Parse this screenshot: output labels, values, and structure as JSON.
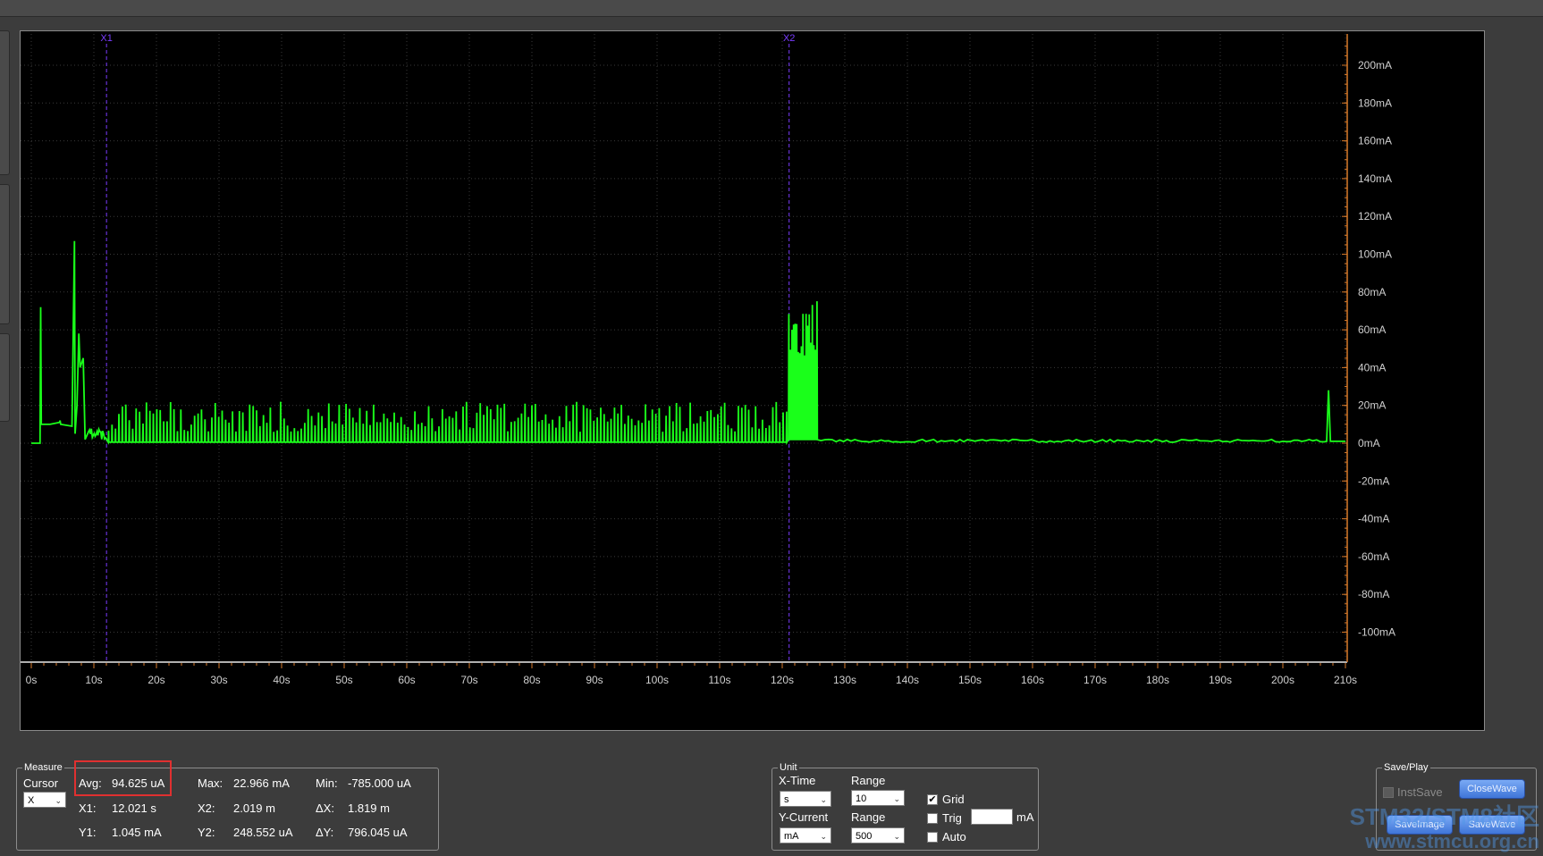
{
  "scope": {
    "x_axis": {
      "labels": [
        "0s",
        "10s",
        "20s",
        "30s",
        "40s",
        "50s",
        "60s",
        "70s",
        "80s",
        "90s",
        "100s",
        "110s",
        "120s",
        "130s",
        "140s",
        "150s",
        "160s",
        "170s",
        "180s",
        "190s",
        "200s",
        "210s"
      ]
    },
    "y_axis": {
      "labels": [
        "200mA",
        "180mA",
        "160mA",
        "140mA",
        "120mA",
        "100mA",
        "80mA",
        "60mA",
        "40mA",
        "20mA",
        "0mA",
        "-20mA",
        "-40mA",
        "-60mA",
        "-80mA",
        "-100mA"
      ]
    },
    "cursor_x1_label": "X1",
    "cursor_x2_label": "X2",
    "trace_color": "#1aff1a",
    "cursor_color": "#7a3cff"
  },
  "measure": {
    "title": "Measure",
    "cursor_label": "Cursor",
    "cursor_value": "X",
    "avg_label": "Avg:",
    "avg_value": "94.625 uA",
    "max_label": "Max:",
    "max_value": "22.966 mA",
    "min_label": "Min:",
    "min_value": "-785.000 uA",
    "x1_label": "X1:",
    "x1_value": "12.021 s",
    "x2_label": "X2:",
    "x2_value": "2.019 m",
    "dx_label": "ΔX:",
    "dx_value": "1.819 m",
    "y1_label": "Y1:",
    "y1_value": "1.045 mA",
    "y2_label": "Y2:",
    "y2_value": "248.552 uA",
    "dy_label": "ΔY:",
    "dy_value": "796.045 uA"
  },
  "unit": {
    "title": "Unit",
    "xtime_label": "X-Time",
    "xtime_value": "s",
    "xrange_label": "Range",
    "xrange_value": "10",
    "ycurrent_label": "Y-Current",
    "ycurrent_value": "mA",
    "yrange_label": "Range",
    "yrange_value": "500",
    "grid_label": "Grid",
    "grid_checked": true,
    "trig_label": "Trig",
    "trig_checked": false,
    "trig_value": "",
    "trig_unit": "mA",
    "auto_label": "Auto",
    "auto_checked": false
  },
  "saveplay": {
    "title": "Save/Play",
    "instsave_label": "InstSave",
    "closewave_label": "CloseWave",
    "saveimage_label": "SaveImage",
    "savewave_label": "SaveWave"
  },
  "watermark": {
    "line1": "STM32/STM8社区",
    "line2": "www.stmcu.org.cn"
  }
}
